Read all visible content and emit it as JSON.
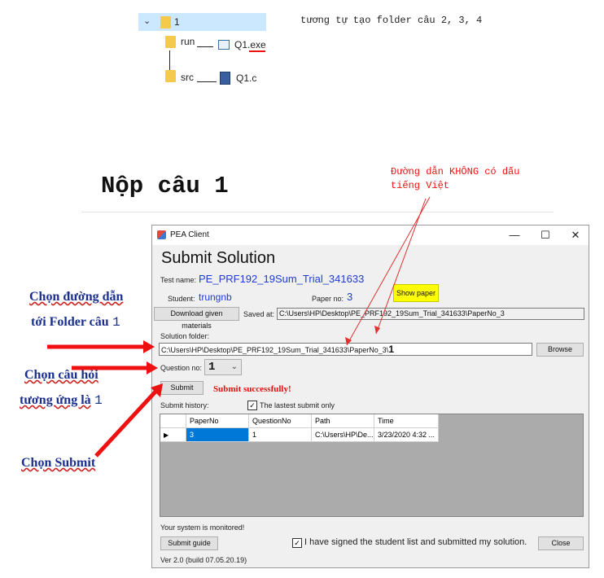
{
  "tree": {
    "root": "1",
    "run_folder": "run",
    "run_file": "Q1.exe",
    "src_folder": "src",
    "src_file": "Q1.c"
  },
  "note_top": "tương tự tạo folder câu 2, 3, 4",
  "heading": "Nộp câu 1",
  "annotations": {
    "path_note_line1": "Đường dẫn KHÔNG có dấu",
    "path_note_line2": "tiếng Việt",
    "choose_path_line1": "Chọn đường dẫn",
    "choose_path_line2": "tới Folder câu",
    "choose_path_num": "1",
    "choose_question_line1": "Chọn câu hỏi",
    "choose_question_line2": "tương ứng là",
    "choose_question_num": "1",
    "choose_submit": "Chọn Submit"
  },
  "window": {
    "title": "PEA Client",
    "minimize": "—",
    "maximize": "☐",
    "close": "✕",
    "header": "Submit Solution",
    "test_name_label": "Test name:",
    "test_name": "PE_PRF192_19Sum_Trial_341633",
    "student_label": "Student:",
    "student": "trungnb",
    "paper_no_label": "Paper no:",
    "paper_no": "3",
    "show_paper": "Show paper",
    "download_btn": "Download given materials",
    "saved_at_label": "Saved at:",
    "saved_at": "C:\\Users\\HP\\Desktop\\PE_PRF192_19Sum_Trial_341633\\PaperNo_3",
    "solution_folder_label": "Solution folder:",
    "solution_folder": "C:\\Users\\HP\\Desktop\\PE_PRF192_19Sum_Trial_341633\\PaperNo_3\\",
    "solution_folder_suffix": "1",
    "browse": "Browse",
    "question_no_label": "Question no:",
    "question_no": "1",
    "submit": "Submit",
    "submit_status": "Submit successfully!",
    "history_label": "Submit history:",
    "lastest_label": "The lastest submit only",
    "lastest_checked": true,
    "table": {
      "columns": [
        "PaperNo",
        "QuestionNo",
        "Path",
        "Time"
      ],
      "rows": [
        [
          "3",
          "1",
          "C:\\Users\\HP\\De...",
          "3/23/2020 4:32 ..."
        ]
      ]
    },
    "monitored": "Your system is monitored!",
    "submit_guide": "Submit guide",
    "signed_label": "I have signed the student list and submitted my solution.",
    "close_btn": "Close",
    "version": "Ver 2.0 (build 07.05.20.19)"
  },
  "colors": {
    "folder": "#f5c94c",
    "arrow_red": "#ee1111",
    "annotation_blue": "#1a2f8c",
    "value_blue": "#1f3bd6",
    "show_paper_bg": "#ffff00",
    "status_red": "#e01010"
  }
}
